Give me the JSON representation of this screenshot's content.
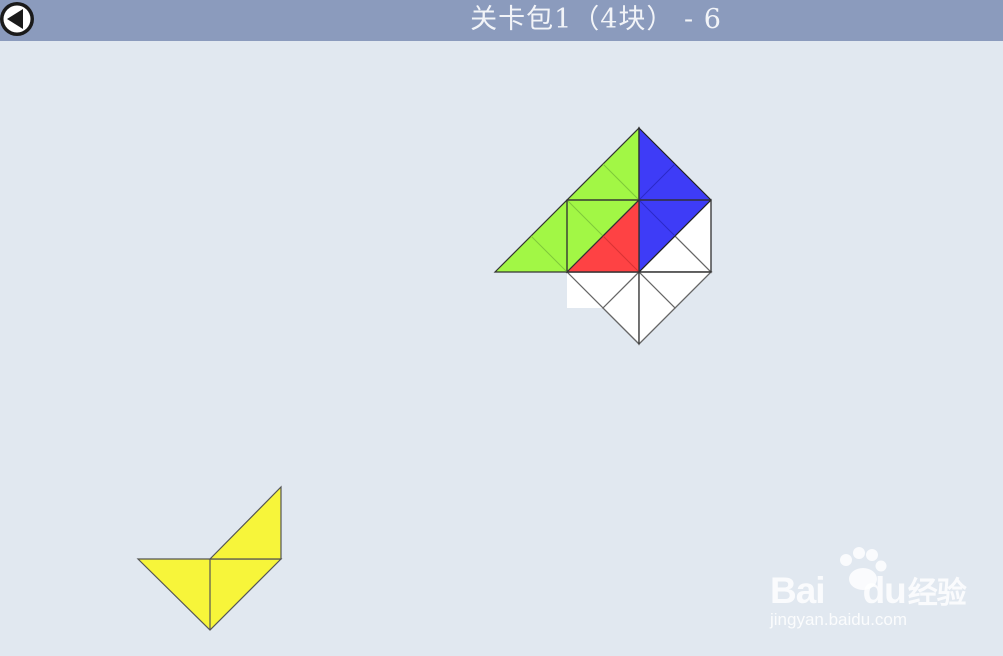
{
  "header": {
    "title": "关卡包1（4块） - 6",
    "back_icon": "back-arrow-icon"
  },
  "colors": {
    "header_bg": "#8b9bbd",
    "background": "#e1e8f0",
    "green_piece": "#a2f745",
    "blue_piece": "#3e3cf7",
    "red_piece": "#fe4244",
    "yellow_piece": "#f7f53a",
    "empty_cell": "#ffffff"
  },
  "puzzle": {
    "pieces_in_target": [
      "green",
      "blue",
      "red"
    ],
    "remaining_piece": "yellow"
  },
  "watermark": {
    "brand_left": "Bai",
    "brand_right": "du",
    "brand_cn": "经验",
    "url": "jingyan.baidu.com"
  }
}
